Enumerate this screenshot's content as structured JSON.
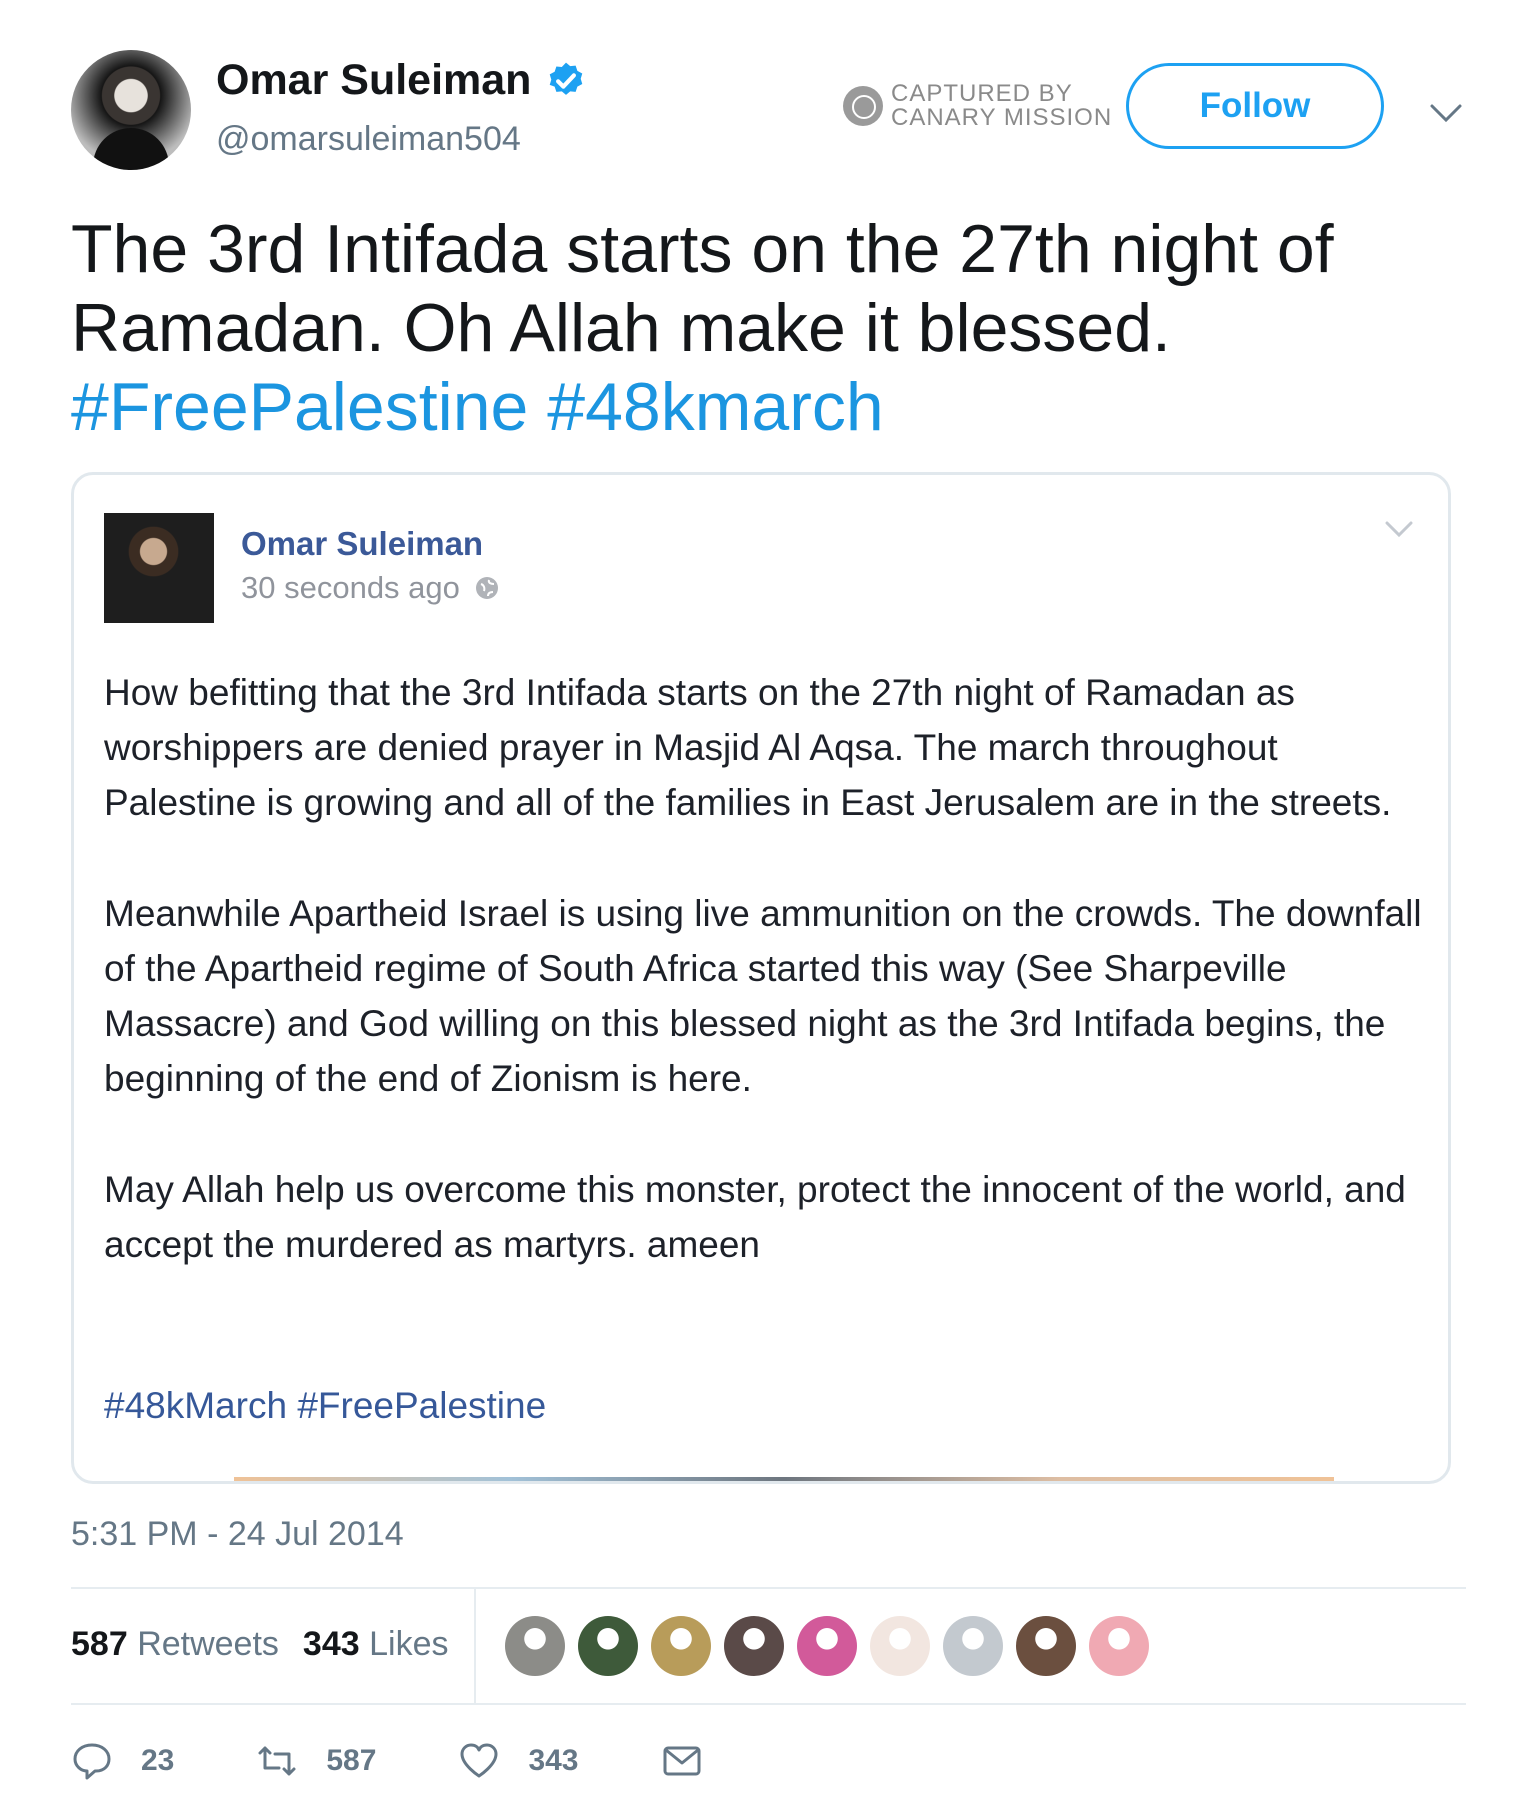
{
  "author": {
    "display_name": "Omar Suleiman",
    "handle": "@omarsuleiman504"
  },
  "watermark": {
    "line1": "CAPTURED BY",
    "line2": "CANARY MISSION"
  },
  "follow_label": "Follow",
  "tweet": {
    "text": "The 3rd Intifada starts on the 27th night of Ramadan. Oh Allah make it blessed.",
    "hashtags": [
      "#FreePalestine",
      "#48kmarch"
    ]
  },
  "embedded_post": {
    "author": "Omar Suleiman",
    "time": "30 seconds ago",
    "paragraphs": [
      "How befitting that the 3rd Intifada starts on the 27th night of Ramadan as worshippers are denied prayer in Masjid Al Aqsa. The march throughout Palestine is growing and all of the families in East Jerusalem are in the streets.",
      "Meanwhile Apartheid Israel is using live ammunition on the crowds. The downfall of the Apartheid regime of South Africa started this way (See Sharpeville Massacre) and God willing on this blessed night as the 3rd Intifada begins, the beginning of the end of Zionism is here.",
      "May Allah help us overcome this monster, protect the innocent of the world, and accept the murdered as martyrs. ameen"
    ],
    "hashtags": [
      "#48kMarch",
      "#FreePalestine"
    ]
  },
  "timestamp": "5:31 PM - 24 Jul 2014",
  "stats": {
    "retweets_count": "587",
    "retweets_label": "Retweets",
    "likes_count": "343",
    "likes_label": "Likes"
  },
  "liker_avatar_colors": [
    "#8c8c88",
    "#3e5a3a",
    "#b89c5a",
    "#5a4a48",
    "#d25a9a",
    "#f2e6e0",
    "#c3c9cf",
    "#6b4f3f",
    "#f0a9b3"
  ],
  "actions": {
    "replies": "23",
    "retweets": "587",
    "likes": "343"
  },
  "colors": {
    "twitter_blue": "#1da1f2",
    "hashtag_blue": "#1b95e0",
    "facebook_blue": "#3b5998",
    "muted_gray": "#657786"
  }
}
